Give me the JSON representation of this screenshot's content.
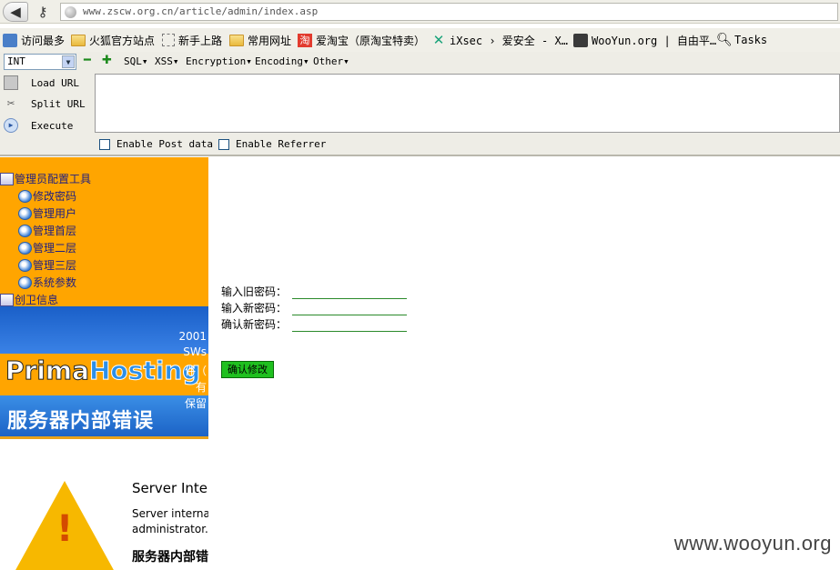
{
  "address_bar": {
    "url": "www.zscw.org.cn/article/admin/index.asp"
  },
  "bookmarks": [
    {
      "label": "访问最多",
      "icon": "visited-icon"
    },
    {
      "label": "火狐官方站点",
      "icon": "folder-icon"
    },
    {
      "label": "新手上路",
      "icon": "dotted-icon"
    },
    {
      "label": "常用网址",
      "icon": "folder-icon"
    },
    {
      "label": "爱淘宝（原淘宝特卖）",
      "icon": "taobao-icon"
    },
    {
      "label": "iXsec › 爱安全 - X…",
      "icon": "ixsec-icon"
    },
    {
      "label": "WooYun.org | 自由平…",
      "icon": "wooyun-icon"
    },
    {
      "label": "Tasks",
      "icon": "search-icon"
    }
  ],
  "hackbar": {
    "select_value": "INT",
    "menus": [
      "SQL▾",
      "XSS▾",
      "Encryption▾",
      "Encoding▾",
      "Other▾"
    ],
    "load_url": "Load URL",
    "split_url": "Split URL",
    "execute": "Execute",
    "enable_post": "Enable Post data",
    "enable_referrer": "Enable Referrer"
  },
  "tree": {
    "root": "管理员配置工具",
    "children": [
      "修改密码",
      "管理用户",
      "管理首层",
      "管理二层",
      "管理三层",
      "系统参数"
    ],
    "root2": "创卫信息"
  },
  "error_page": {
    "logo_prima": "Prima",
    "logo_hosting": "Hosting",
    "side_lines": [
      "2001",
      "SWs",
      "件（",
      "有",
      "保留"
    ],
    "heading": "服务器内部错误",
    "title": "Server Inte",
    "body": "Server internal administrator.",
    "cn_heading": "服务器内部错"
  },
  "form": {
    "old_password_label": "输入旧密码：",
    "new_password_label": "输入新密码：",
    "confirm_password_label": "确认新密码：",
    "submit_label": "确认修改"
  },
  "watermark": "www.wooyun.org"
}
